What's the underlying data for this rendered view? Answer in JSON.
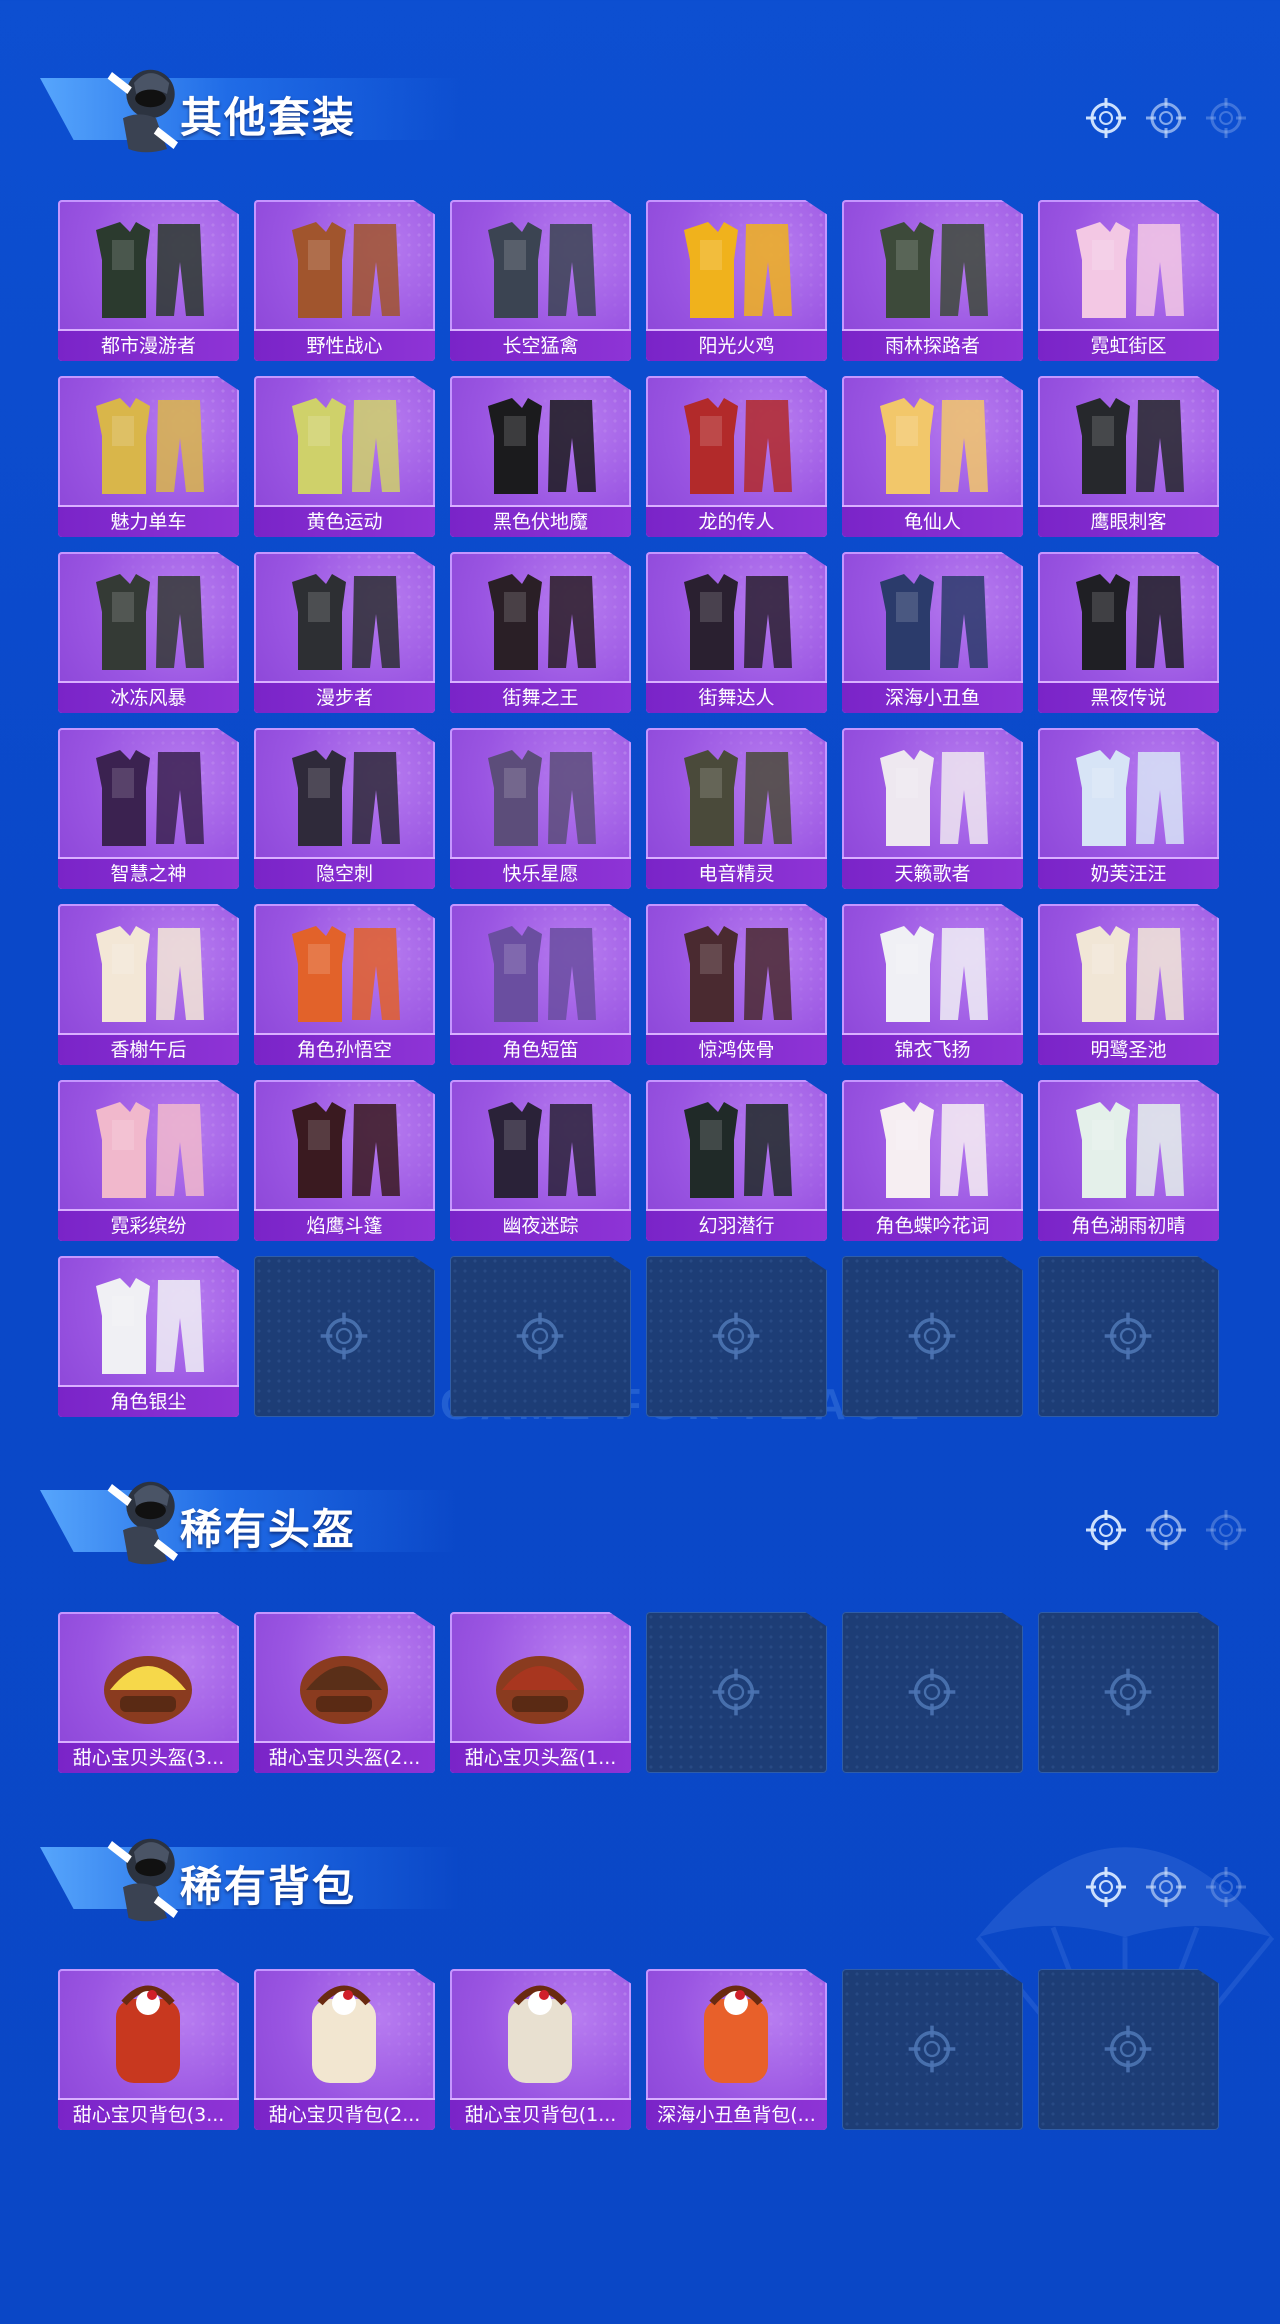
{
  "colors": {
    "background": "#0a48c9",
    "card_purple": "#9a55e2",
    "label_bar": "#7a24c8",
    "empty_card": "#1d3d76"
  },
  "watermark": "GAME FOR PEACE",
  "sections": [
    {
      "title": "其他套装",
      "items": [
        {
          "label": "都市漫游者"
        },
        {
          "label": "野性战心"
        },
        {
          "label": "长空猛禽"
        },
        {
          "label": "阳光火鸡"
        },
        {
          "label": "雨林探路者"
        },
        {
          "label": "霓虹街区"
        },
        {
          "label": "魅力单车"
        },
        {
          "label": "黄色运动"
        },
        {
          "label": "黑色伏地魔"
        },
        {
          "label": "龙的传人"
        },
        {
          "label": "龟仙人"
        },
        {
          "label": "鹰眼刺客"
        },
        {
          "label": "冰冻风暴"
        },
        {
          "label": "漫步者"
        },
        {
          "label": "街舞之王"
        },
        {
          "label": "街舞达人"
        },
        {
          "label": "深海小丑鱼"
        },
        {
          "label": "黑夜传说"
        },
        {
          "label": "智慧之神"
        },
        {
          "label": "隐空刺"
        },
        {
          "label": "快乐星愿"
        },
        {
          "label": "电音精灵"
        },
        {
          "label": "天籁歌者"
        },
        {
          "label": "奶芙汪汪"
        },
        {
          "label": "香榭午后"
        },
        {
          "label": "角色孙悟空"
        },
        {
          "label": "角色短笛"
        },
        {
          "label": "惊鸿侠骨"
        },
        {
          "label": "锦衣飞扬"
        },
        {
          "label": "明鹭圣池"
        },
        {
          "label": "霓彩缤纷"
        },
        {
          "label": "焰鹰斗篷"
        },
        {
          "label": "幽夜迷踪"
        },
        {
          "label": "幻羽潜行"
        },
        {
          "label": "角色蝶吟花词"
        },
        {
          "label": "角色湖雨初晴"
        },
        {
          "label": "角色银尘"
        },
        {
          "label": ""
        },
        {
          "label": ""
        },
        {
          "label": ""
        },
        {
          "label": ""
        },
        {
          "label": ""
        }
      ]
    },
    {
      "title": "稀有头盔",
      "items": [
        {
          "label": "甜心宝贝头盔(3..."
        },
        {
          "label": "甜心宝贝头盔(2..."
        },
        {
          "label": "甜心宝贝头盔(1..."
        },
        {
          "label": ""
        },
        {
          "label": ""
        },
        {
          "label": ""
        }
      ]
    },
    {
      "title": "稀有背包",
      "items": [
        {
          "label": "甜心宝贝背包(3..."
        },
        {
          "label": "甜心宝贝背包(2..."
        },
        {
          "label": "甜心宝贝背包(1..."
        },
        {
          "label": "深海小丑鱼背包(..."
        },
        {
          "label": ""
        },
        {
          "label": ""
        }
      ]
    }
  ]
}
